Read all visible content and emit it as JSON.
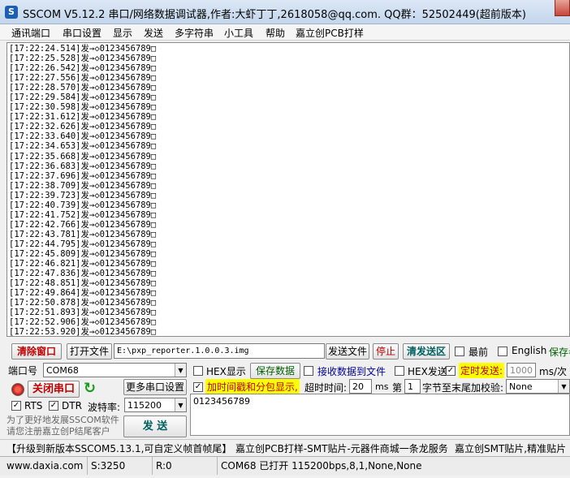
{
  "window": {
    "title": "SSCOM V5.12.2 串口/网络数据调试器,作者:大虾丁丁,2618058@qq.com. QQ群：52502449(超前版本)"
  },
  "menu": [
    "通讯端口",
    "串口设置",
    "显示",
    "发送",
    "多字符串",
    "小工具",
    "帮助",
    "嘉立创PCB打样"
  ],
  "log_lines": [
    "[17:22:24.514]发→◇0123456789□",
    "[17:22:25.528]发→◇0123456789□",
    "[17:22:26.542]发→◇0123456789□",
    "[17:22:27.556]发→◇0123456789□",
    "[17:22:28.570]发→◇0123456789□",
    "[17:22:29.584]发→◇0123456789□",
    "[17:22:30.598]发→◇0123456789□",
    "[17:22:31.612]发→◇0123456789□",
    "[17:22:32.626]发→◇0123456789□",
    "[17:22:33.640]发→◇0123456789□",
    "[17:22:34.653]发→◇0123456789□",
    "[17:22:35.668]发→◇0123456789□",
    "[17:22:36.683]发→◇0123456789□",
    "[17:22:37.696]发→◇0123456789□",
    "[17:22:38.709]发→◇0123456789□",
    "[17:22:39.723]发→◇0123456789□",
    "[17:22:40.739]发→◇0123456789□",
    "[17:22:41.752]发→◇0123456789□",
    "[17:22:42.766]发→◇0123456789□",
    "[17:22:43.781]发→◇0123456789□",
    "[17:22:44.795]发→◇0123456789□",
    "[17:22:45.809]发→◇0123456789□",
    "[17:22:46.821]发→◇0123456789□",
    "[17:22:47.836]发→◇0123456789□",
    "[17:22:48.851]发→◇0123456789□",
    "[17:22:49.864]发→◇0123456789□",
    "[17:22:50.878]发→◇0123456789□",
    "[17:22:51.893]发→◇0123456789□",
    "[17:22:52.906]发→◇0123456789□",
    "[17:22:53.920]发→◇0123456789□"
  ],
  "toolbar": {
    "clear_window": "清除窗口",
    "open_file": "打开文件",
    "file_path": "E:\\pxp_reporter.1.0.0.3.img",
    "send_file": "发送文件",
    "stop": "停止",
    "clear_send": "清发送区",
    "topmost": "最前",
    "english": "English",
    "save_params": "保存参"
  },
  "port": {
    "label": "端口号",
    "value": "COM68",
    "close_port": "关闭串口",
    "more_settings": "更多串口设置",
    "rts": "RTS",
    "dtr": "DTR",
    "baud_label": "波特率:",
    "baud_value": "115200",
    "support_text": "为了更好地发展SSCOM软件\n请您注册嘉立创P结尾客户"
  },
  "receive": {
    "hex_display": "HEX显示",
    "save_data": "保存数据",
    "recv_to_file": "接收数据到文件",
    "hex_send": "HEX发送",
    "timed_send": "定时发送:",
    "interval": "1000",
    "interval_unit": "ms/次",
    "timestamp": "加时间戳和分包显示,",
    "timeout_label": "超时时间:",
    "timeout_value": "20",
    "timeout_unit": "ms",
    "byte_prefix": "第",
    "byte_index": "1",
    "checksum_label": "字节至末尾加校验:",
    "checksum_value": "None"
  },
  "send": {
    "button": "发 送",
    "content": "0123456789"
  },
  "promo": {
    "text1": "【升级到新版本SSCOM5.13.1,可自定义帧首帧尾】",
    "text2": "嘉立创PCB打样-SMT贴片-元器件商城一条龙服务",
    "text3": "嘉立创SMT贴片,精准贴片"
  },
  "status": {
    "website": "www.daxia.com",
    "sent": "S:3250",
    "received": "R:0",
    "port_state": "COM68 已打开  115200bps,8,1,None,None"
  },
  "colors": {
    "accent": "#ffff00",
    "red": "#c00000",
    "teal": "#006060"
  }
}
